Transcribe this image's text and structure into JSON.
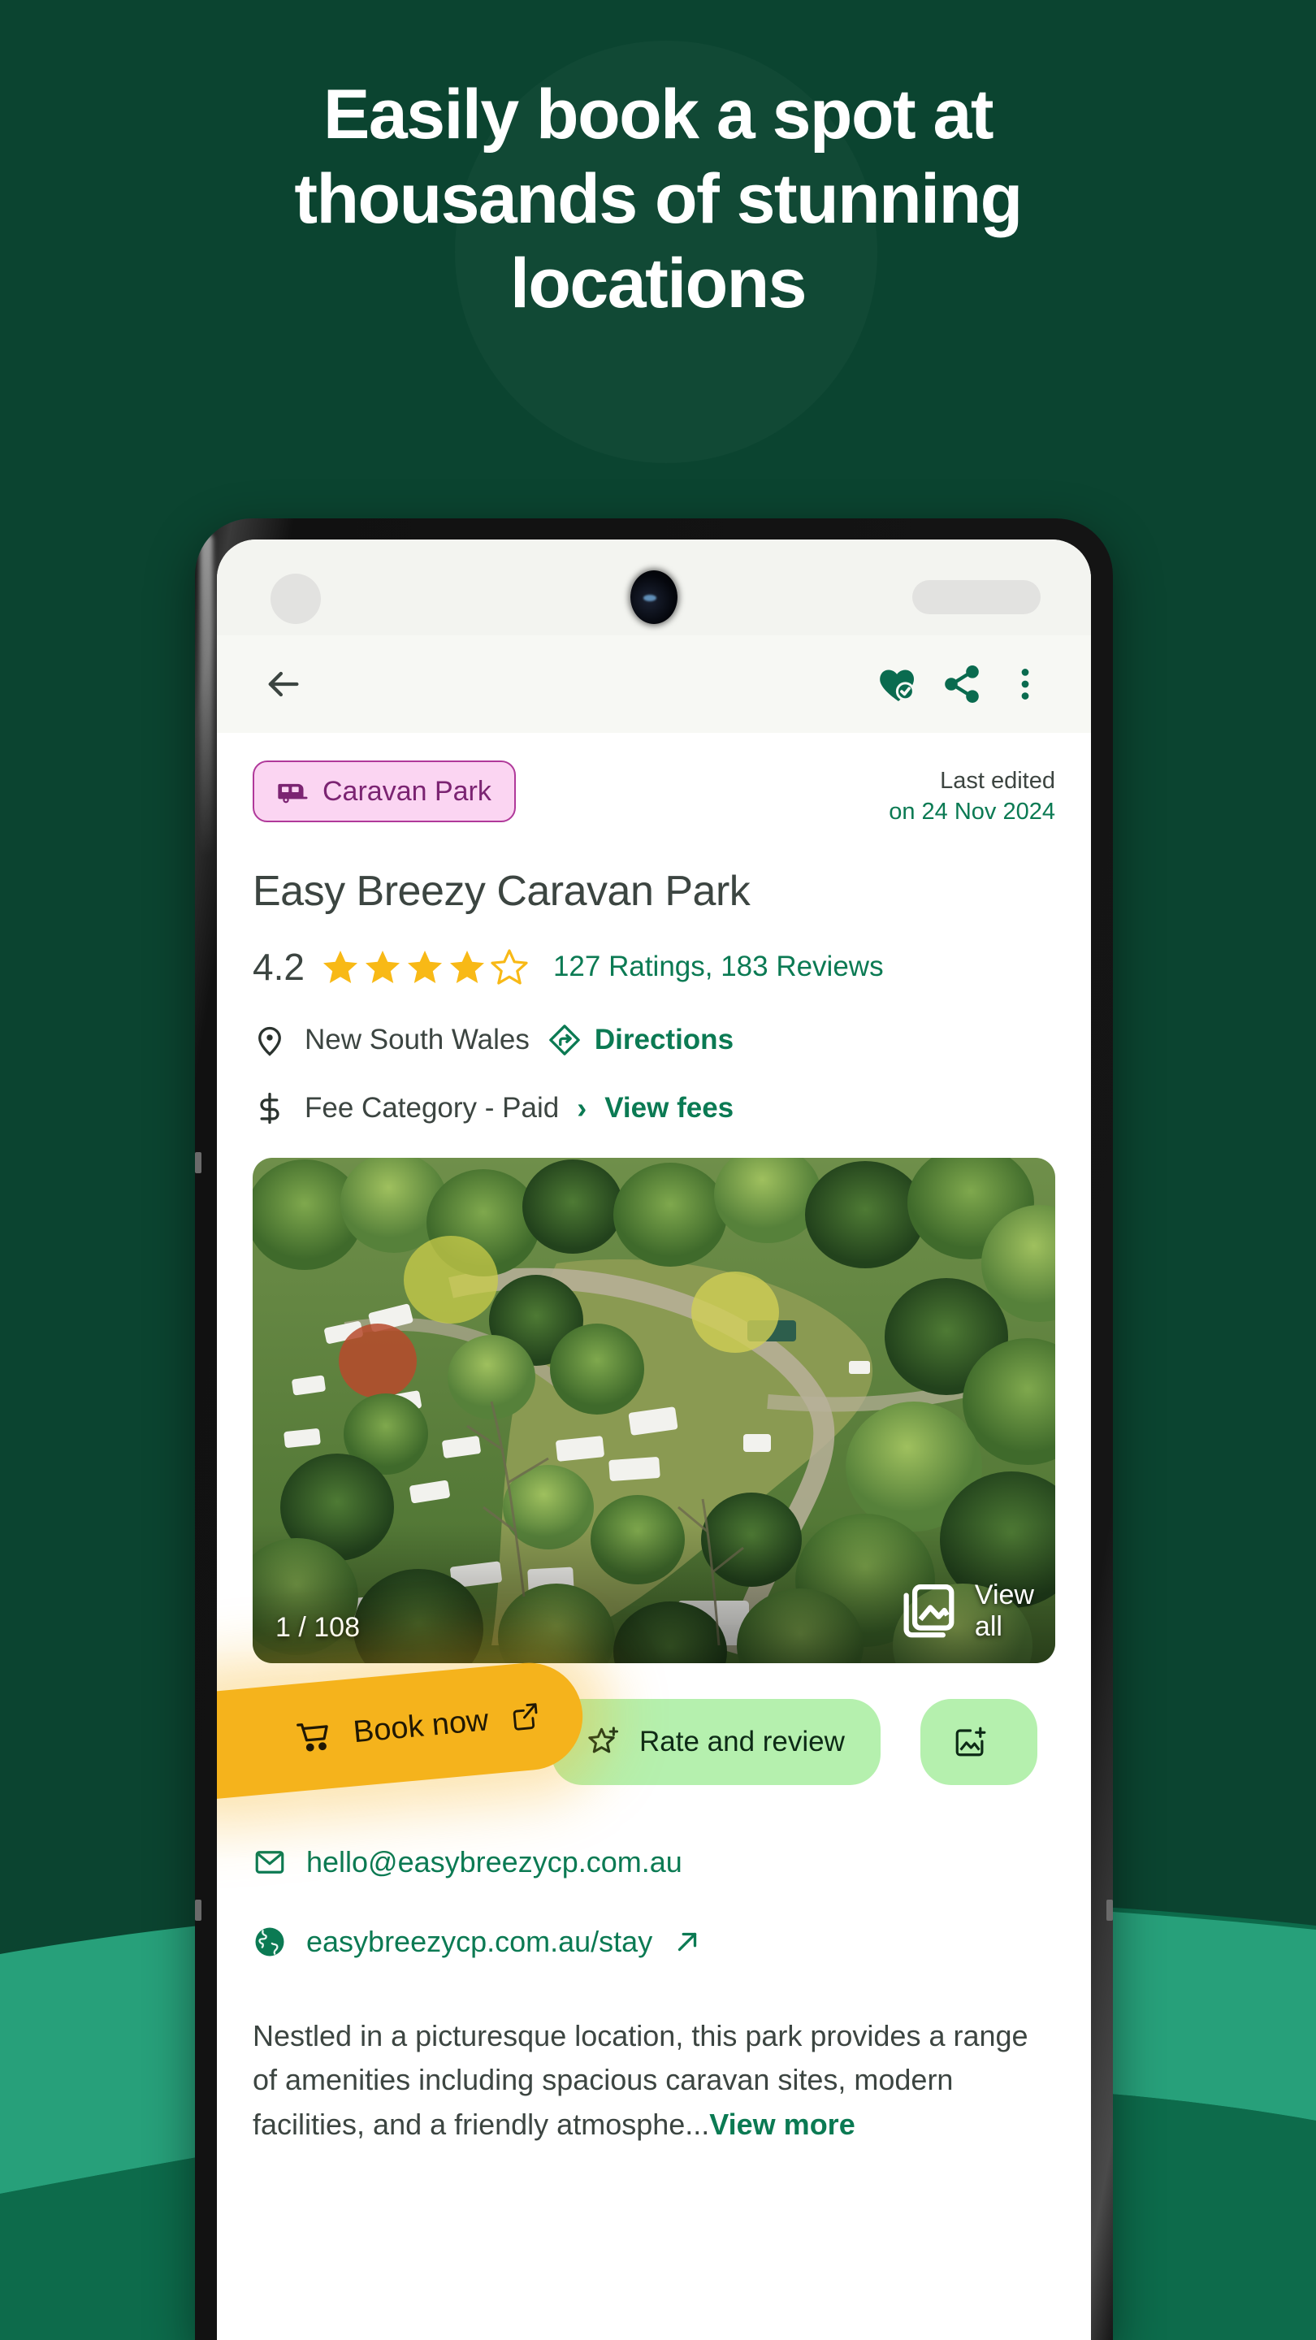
{
  "hero": {
    "headline_lines": [
      "Easily book a spot at",
      "thousands of stunning",
      "locations"
    ]
  },
  "colors": {
    "background_green": "#0B4430",
    "wave_mid": "#2AA77B",
    "wave_light": "#27A07A",
    "wave_dark": "#0D6B4B",
    "accent_green": "#0B7A53",
    "badge_pink_bg": "#FBD5F2",
    "badge_pink_border": "#B0399A",
    "badge_pink_text": "#7B2472",
    "book_now_amber": "#F5B31C",
    "chip_green": "#B5F0AE",
    "star_gold": "#F8B916",
    "body_text": "#3C4541"
  },
  "phone": {
    "statusbar": {
      "left_placeholder": "status-left-pill",
      "camera": "front-camera-punch-hole",
      "right_placeholder": "status-right-pill"
    },
    "appbar": {
      "back_icon": "back-arrow-icon",
      "favorite_icon": "heart-check-icon",
      "share_icon": "share-icon",
      "menu_icon": "overflow-menu-icon"
    }
  },
  "listing": {
    "category_badge": {
      "icon": "caravan-icon",
      "label": "Caravan Park"
    },
    "last_edited": {
      "line1": "Last edited",
      "line2": "on 24 Nov 2024"
    },
    "title": "Easy Breezy Caravan Park",
    "rating": {
      "score": "4.2",
      "stars_filled": 4,
      "stars_total": 5,
      "reviews_text": "127 Ratings, 183 Reviews"
    },
    "location": {
      "icon": "location-pin-icon",
      "text": "New South Wales",
      "directions_icon": "directions-icon",
      "directions_label": "Directions"
    },
    "fee": {
      "icon": "dollar-sign-icon",
      "text": "Fee Category - Paid",
      "chevron": "chevron-right-icon",
      "view_fees_label": "View fees"
    },
    "photo": {
      "counter": "1 / 108",
      "view_all_label": "View all",
      "view_all_icon": "photo-library-icon",
      "alt": "aerial-view-of-caravan-park"
    },
    "actions": [
      {
        "key": "book-now",
        "label": "Book now",
        "icon": "shopping-cart-icon",
        "trailing_icon": "external-link-icon"
      },
      {
        "key": "rate-and-review",
        "label": "Rate and review",
        "icon": "star-plus-icon",
        "trailing_icon": ""
      },
      {
        "key": "add-photo",
        "label": "",
        "icon": "add-photo-icon",
        "trailing_icon": ""
      }
    ],
    "contact": {
      "email_icon": "email-icon",
      "email": "hello@easybreezycp.com.au",
      "website_icon": "globe-icon",
      "website": "easybreezycp.com.au/stay",
      "website_trailing_icon": "arrow-up-right-icon"
    },
    "description": {
      "text": "Nestled in a picturesque location, this park provides a range of amenities including spacious caravan sites, modern facilities, and a friendly atmosphe...",
      "view_more_label": "View more"
    }
  }
}
